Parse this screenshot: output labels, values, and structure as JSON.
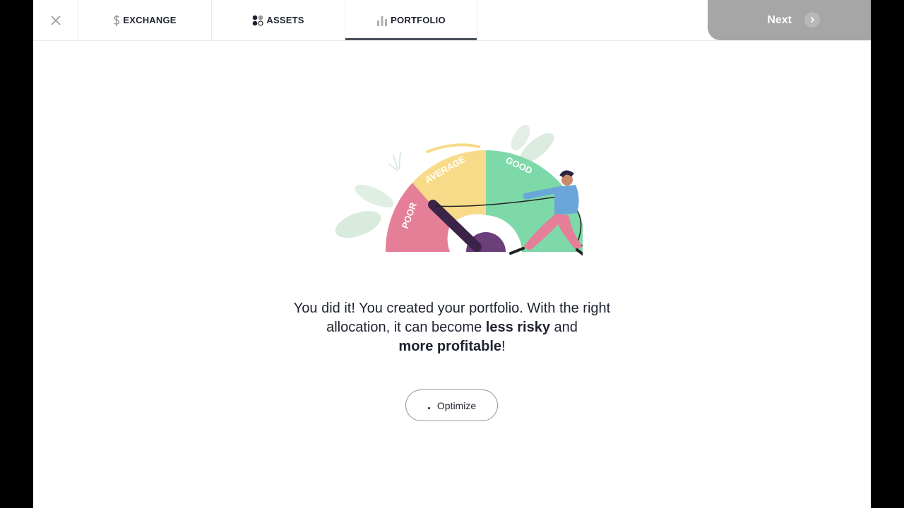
{
  "nav": {
    "tabs": [
      {
        "label": "EXCHANGE",
        "icon": "dollar-icon"
      },
      {
        "label": "ASSETS",
        "icon": "assets-dots-icon"
      },
      {
        "label": "PORTFOLIO",
        "icon": "bar-chart-icon",
        "active": true
      }
    ],
    "next_label": "Next"
  },
  "illustration": {
    "gauge_labels": [
      "POOR",
      "AVERAGE",
      "GOOD"
    ],
    "colors": {
      "poor": "#e57f97",
      "average": "#f7db88",
      "good": "#7ed9a8"
    }
  },
  "message": {
    "part1": "You did it! You created your portfolio. With the right allocation, it can become ",
    "bold1": "less risky",
    "part2": " and ",
    "bold2": "more profitable",
    "part3": "!"
  },
  "optimize_button": {
    "label": "Optimize"
  }
}
